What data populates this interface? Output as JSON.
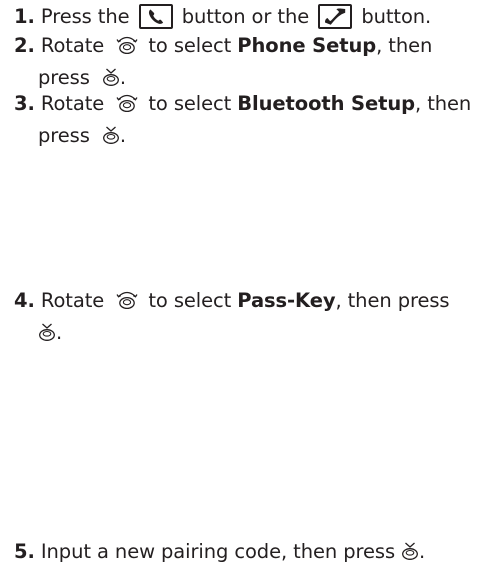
{
  "steps": [
    {
      "number": "1.",
      "t1": "Press the",
      "t2": "button or the",
      "t3": "button.",
      "icons": [
        "phone-pickup-icon",
        "phone-hangup-icon"
      ]
    },
    {
      "number": "2.",
      "t1": "Rotate",
      "t2": "to select",
      "target": "Phone Setup",
      "t3": ", then",
      "t4": "press",
      "t5": ".",
      "icons": [
        "selector-knob-icon",
        "enter-button-icon"
      ]
    },
    {
      "number": "3.",
      "t1": "Rotate",
      "t2": "to select",
      "target": "Bluetooth Setup",
      "t3": ", then",
      "t4": "press",
      "t5": ".",
      "icons": [
        "selector-knob-icon",
        "enter-button-icon"
      ]
    },
    {
      "number": "4.",
      "t1": "Rotate",
      "t2": "to select",
      "target": "Pass-Key",
      "t3": ", then press",
      "t5": ".",
      "icons": [
        "selector-knob-icon",
        "enter-button-icon"
      ]
    },
    {
      "number": "5.",
      "t1": "Input a new pairing code, then press",
      "t5": ".",
      "icons": [
        "enter-button-icon"
      ]
    }
  ],
  "colors": {
    "text": "#231f20",
    "background": "#ffffff"
  }
}
